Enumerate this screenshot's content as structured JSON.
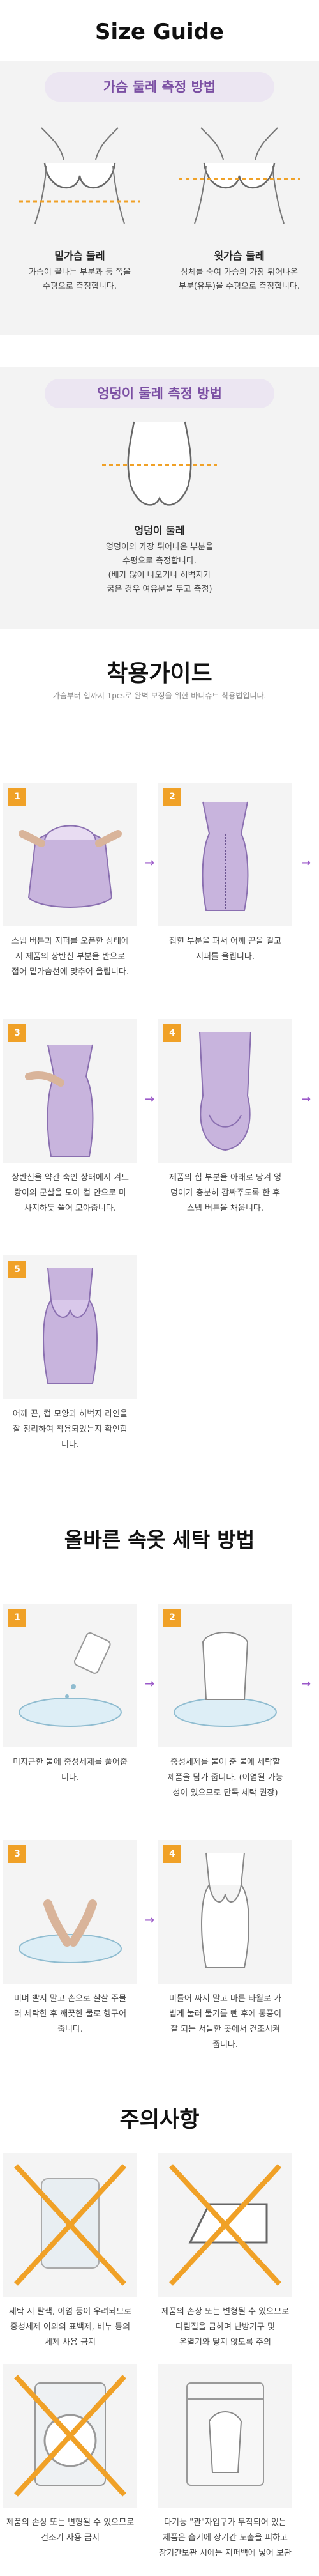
{
  "size_guide": {
    "title": "Size Guide",
    "bust_banner": "가슴 둘레 측정 방법",
    "under_bust": {
      "label": "밑가슴 둘레",
      "desc": [
        "가슴이 끝나는 부분과 등 쪽을",
        "수평으로 측정합니다."
      ]
    },
    "top_bust": {
      "label": "윗가슴 둘레",
      "desc": [
        "상체를 숙여 가슴의 가장 튀어나온",
        "부분(유두)을 수평으로 측정합니다."
      ]
    },
    "hip_banner": "엉덩이 둘레 측정 방법",
    "hip": {
      "label": "엉덩이 둘레",
      "desc": [
        "엉덩이의 가장 튀어나온 부분을",
        "수평으로 측정합니다.",
        "(배가 많이 나오거나 허벅지가",
        "굵은 경우 여유분을 두고 측정)"
      ]
    }
  },
  "wearing_guide": {
    "title": "착용가이드",
    "subtitle": "가슴부터 힙까지 1pcs로 완벽 보정을 위한 바디슈트 착용법입니다.",
    "steps": [
      {
        "num": "1",
        "text": [
          "스냅 버튼과 지퍼를 오픈한 상태에",
          "서 제품의 상반신 부분을 반으로",
          "접어 밑가슴선에 맞추어 올립니다."
        ]
      },
      {
        "num": "2",
        "text": [
          "접힌 부분을 펴서 어깨 끈을 걸고",
          "지퍼를 올립니다."
        ]
      },
      {
        "num": "3",
        "text": [
          "상반신을 약간 숙인 상태에서 겨드",
          "랑이의 군살을 모아 컵 안으로 마",
          "사지하듯 쓸어 모아줍니다."
        ]
      },
      {
        "num": "4",
        "text": [
          "제품의 힙 부분을 아래로 당겨 엉",
          "덩이가 충분히 감싸주도록 한 후",
          "스냅 버튼을 채웁니다."
        ]
      },
      {
        "num": "5",
        "text": [
          "어깨 끈, 컵 모양과 허벅지 라인을",
          "잘 정리하여 착용되었는지 확인합",
          "니다."
        ]
      }
    ]
  },
  "washing": {
    "title": "올바른 속옷 세탁 방법",
    "steps": [
      {
        "num": "1",
        "text": [
          "미지근한 물에 중성세제를 풀어줍",
          "니다."
        ]
      },
      {
        "num": "2",
        "text": [
          "중성세제를 물이 준 물에 세탁할",
          "제품을 담가 줍니다. (이염될 가능",
          "성이 있으므로 단독 세탁 권장)"
        ]
      },
      {
        "num": "3",
        "text": [
          "비벼 빨지 말고 손으로 살살 주물",
          "러 세탁한 후 깨끗한 물로 헹구어",
          "줍니다."
        ]
      },
      {
        "num": "4",
        "text": [
          "비틀어 짜지 말고 마른 타월로 가",
          "볍게 눌러 물기를 뺀 후에 통풍이",
          "잘 되는 서늘한 곳에서 건조시켜",
          "줍니다."
        ]
      }
    ]
  },
  "cautions": {
    "title": "주의사항",
    "items": [
      {
        "text": [
          "세탁 시 탈색, 이염 등이 우려되므로",
          "중성세제 이외의 표백제, 비누 등의",
          "세제 사용 금지"
        ]
      },
      {
        "text": [
          "제품의 손상 또는 변형될 수 있으므로",
          "다림질을 금하며 난방기구 및",
          "온열기와 닿지 않도록 주의"
        ]
      },
      {
        "text": [
          "제품의 손상 또는 변형될 수 있으므로",
          "건조기 사용 금지"
        ]
      },
      {
        "text": [
          "다기능 \"관\"자업구가 무작되어 있는",
          "제품은 습기에 장기간 노출을 피하고",
          "장기간보관 시에는 지퍼백에 넣어 보관"
        ]
      }
    ]
  },
  "colors": {
    "accent": "#f0a127",
    "purple": "#9b59c9",
    "banner_bg": "#ece6f2",
    "banner_text": "#7b4fa3"
  }
}
